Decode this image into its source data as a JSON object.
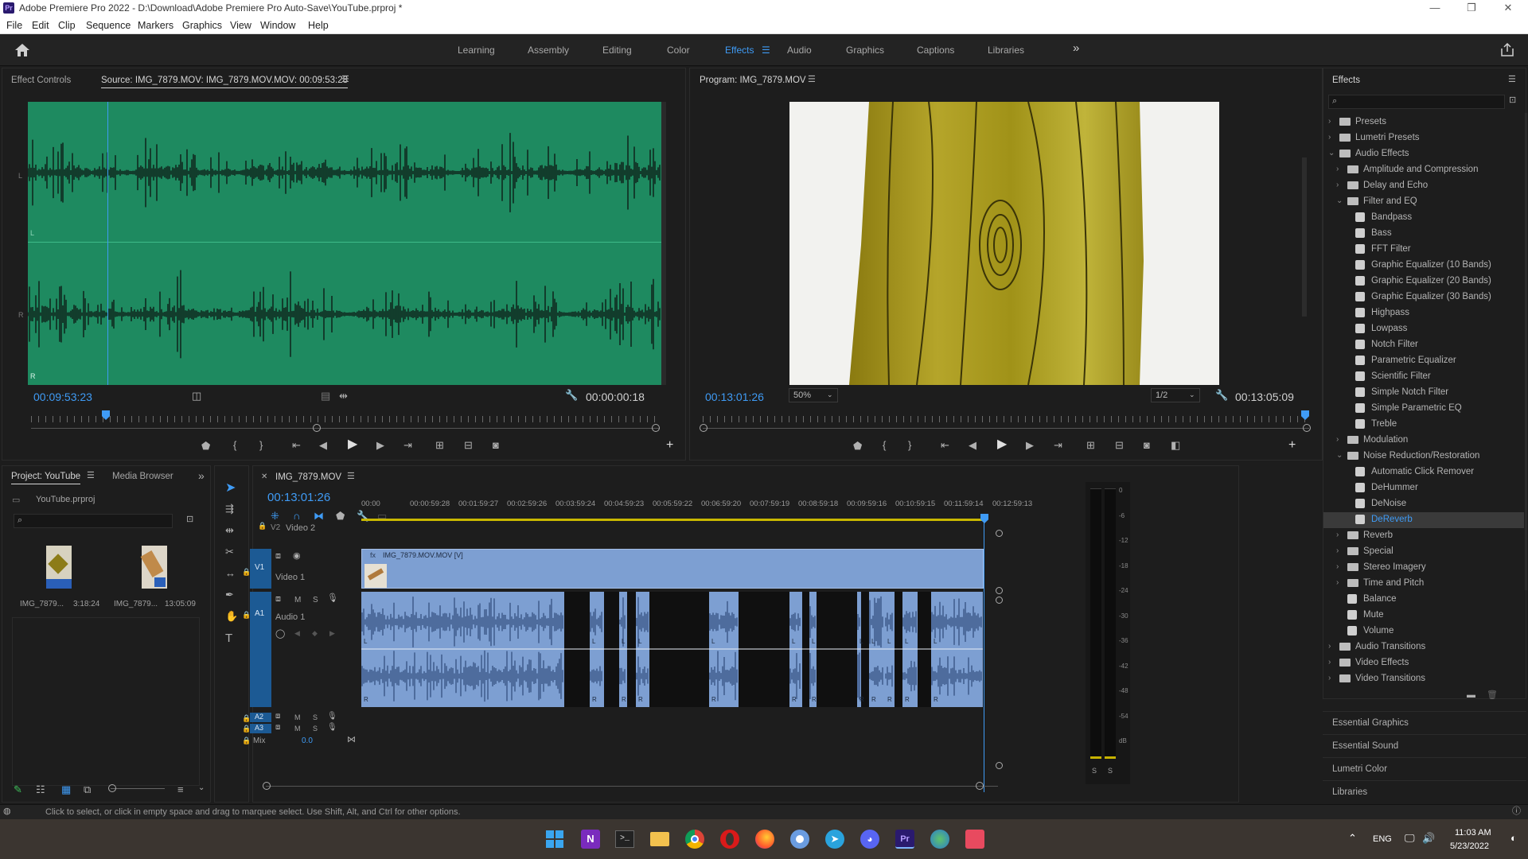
{
  "window": {
    "title": "Adobe Premiere Pro 2022 - D:\\Download\\Adobe Premiere Pro Auto-Save\\YouTube.prproj *",
    "app_icon": "Pr",
    "controls": [
      "—",
      "❐",
      "✕"
    ]
  },
  "menu": [
    "File",
    "Edit",
    "Clip",
    "Sequence",
    "Markers",
    "Graphics",
    "View",
    "Window",
    "Help"
  ],
  "workspaces": {
    "items": [
      "Learning",
      "Assembly",
      "Editing",
      "Color",
      "Effects",
      "Audio",
      "Graphics",
      "Captions",
      "Libraries"
    ],
    "active": "Effects",
    "more": "»"
  },
  "source_panel": {
    "tab_effect_controls": "Effect Controls",
    "tab_source": "Source: IMG_7879.MOV: IMG_7879.MOV.MOV: 00:09:53:28",
    "timecode_left": "00:09:53:23",
    "timecode_right": "00:00:00:18",
    "channel_labels": [
      "L",
      "L",
      "R",
      "R"
    ],
    "waveform_bg": "#1e8a60"
  },
  "program_panel": {
    "title": "Program: IMG_7879.MOV",
    "timecode_left": "00:13:01:26",
    "timecode_right": "00:13:05:09",
    "zoom": "50%",
    "resolution": "1/2"
  },
  "project_panel": {
    "tab_project": "Project: YouTube",
    "tab_media_browser": "Media Browser",
    "project_file": "YouTube.prproj",
    "search_placeholder": "",
    "items": [
      {
        "name": "IMG_7879...",
        "duration": "3:18:24"
      },
      {
        "name": "IMG_7879...",
        "duration": "13:05:09"
      }
    ]
  },
  "timeline": {
    "tab": "IMG_7879.MOV",
    "timecode": "00:13:01:26",
    "ruler": [
      "00:00",
      "00:00:59:28",
      "00:01:59:27",
      "00:02:59:26",
      "00:03:59:24",
      "00:04:59:23",
      "00:05:59:22",
      "00:06:59:20",
      "00:07:59:19",
      "00:08:59:18",
      "00:09:59:16",
      "00:10:59:15",
      "00:11:59:14",
      "00:12:59:13"
    ],
    "tracks": {
      "v2": {
        "id": "V2",
        "name": "Video 2"
      },
      "v1": {
        "id": "V1",
        "name": "Video 1",
        "clip": "IMG_7879.MOV.MOV [V]"
      },
      "a1": {
        "id": "A1",
        "name": "Audio 1",
        "m": "M",
        "s": "S"
      },
      "a2": {
        "id": "A2",
        "m": "M",
        "s": "S"
      },
      "a3": {
        "id": "A3",
        "m": "M",
        "s": "S"
      },
      "mix": {
        "label": "Mix",
        "value": "0.0"
      }
    },
    "clip_channel_labels": [
      "L",
      "R"
    ],
    "fx_badge": "fx"
  },
  "meters": {
    "scale": [
      "0",
      "-6",
      "-12",
      "-18",
      "-24",
      "-30",
      "-36",
      "-42",
      "-48",
      "-54",
      "dB"
    ],
    "solo_buttons": [
      "S",
      "S"
    ]
  },
  "effects_panel": {
    "title": "Effects",
    "tree": [
      {
        "label": "Presets",
        "level": 0,
        "type": "folder",
        "state": "collapsed"
      },
      {
        "label": "Lumetri Presets",
        "level": 0,
        "type": "folder",
        "state": "collapsed"
      },
      {
        "label": "Audio Effects",
        "level": 0,
        "type": "folder",
        "state": "expanded"
      },
      {
        "label": "Amplitude and Compression",
        "level": 1,
        "type": "folder",
        "state": "collapsed"
      },
      {
        "label": "Delay and Echo",
        "level": 1,
        "type": "folder",
        "state": "collapsed"
      },
      {
        "label": "Filter and EQ",
        "level": 1,
        "type": "folder",
        "state": "expanded"
      },
      {
        "label": "Bandpass",
        "level": 2,
        "type": "effect"
      },
      {
        "label": "Bass",
        "level": 2,
        "type": "effect"
      },
      {
        "label": "FFT Filter",
        "level": 2,
        "type": "effect"
      },
      {
        "label": "Graphic Equalizer (10 Bands)",
        "level": 2,
        "type": "effect"
      },
      {
        "label": "Graphic Equalizer (20 Bands)",
        "level": 2,
        "type": "effect"
      },
      {
        "label": "Graphic Equalizer (30 Bands)",
        "level": 2,
        "type": "effect"
      },
      {
        "label": "Highpass",
        "level": 2,
        "type": "effect"
      },
      {
        "label": "Lowpass",
        "level": 2,
        "type": "effect"
      },
      {
        "label": "Notch Filter",
        "level": 2,
        "type": "effect"
      },
      {
        "label": "Parametric Equalizer",
        "level": 2,
        "type": "effect"
      },
      {
        "label": "Scientific Filter",
        "level": 2,
        "type": "effect"
      },
      {
        "label": "Simple Notch Filter",
        "level": 2,
        "type": "effect"
      },
      {
        "label": "Simple Parametric EQ",
        "level": 2,
        "type": "effect"
      },
      {
        "label": "Treble",
        "level": 2,
        "type": "effect"
      },
      {
        "label": "Modulation",
        "level": 1,
        "type": "folder",
        "state": "collapsed"
      },
      {
        "label": "Noise Reduction/Restoration",
        "level": 1,
        "type": "folder",
        "state": "expanded"
      },
      {
        "label": "Automatic Click Remover",
        "level": 2,
        "type": "effect"
      },
      {
        "label": "DeHummer",
        "level": 2,
        "type": "effect"
      },
      {
        "label": "DeNoise",
        "level": 2,
        "type": "effect"
      },
      {
        "label": "DeReverb",
        "level": 2,
        "type": "effect",
        "selected": true
      },
      {
        "label": "Reverb",
        "level": 1,
        "type": "folder",
        "state": "collapsed"
      },
      {
        "label": "Special",
        "level": 1,
        "type": "folder",
        "state": "collapsed"
      },
      {
        "label": "Stereo Imagery",
        "level": 1,
        "type": "folder",
        "state": "collapsed"
      },
      {
        "label": "Time and Pitch",
        "level": 1,
        "type": "folder",
        "state": "collapsed"
      },
      {
        "label": "Balance",
        "level": 1,
        "type": "effect"
      },
      {
        "label": "Mute",
        "level": 1,
        "type": "effect"
      },
      {
        "label": "Volume",
        "level": 1,
        "type": "effect"
      },
      {
        "label": "Audio Transitions",
        "level": 0,
        "type": "folder",
        "state": "collapsed"
      },
      {
        "label": "Video Effects",
        "level": 0,
        "type": "folder",
        "state": "collapsed"
      },
      {
        "label": "Video Transitions",
        "level": 0,
        "type": "folder",
        "state": "collapsed"
      }
    ],
    "bottom_panels": [
      "Essential Graphics",
      "Essential Sound",
      "Lumetri Color",
      "Libraries"
    ]
  },
  "status": {
    "message": "Click to select, or click in empty space and drag to marquee select. Use Shift, Alt, and Ctrl for other options."
  },
  "taskbar": {
    "apps": [
      "windows-start",
      "onenote",
      "terminal",
      "file-explorer",
      "chrome",
      "opera",
      "firefox",
      "chrome-alt",
      "telegram",
      "discord",
      "premiere",
      "maps",
      "snip"
    ],
    "language": "ENG",
    "time": "11:03 AM",
    "date": "5/23/2022"
  },
  "colors": {
    "accent": "#3f9bf5",
    "clip_blue": "#7d9fd2",
    "waveform_green": "#1e8a60",
    "track_header_blue": "#1c5a94"
  }
}
